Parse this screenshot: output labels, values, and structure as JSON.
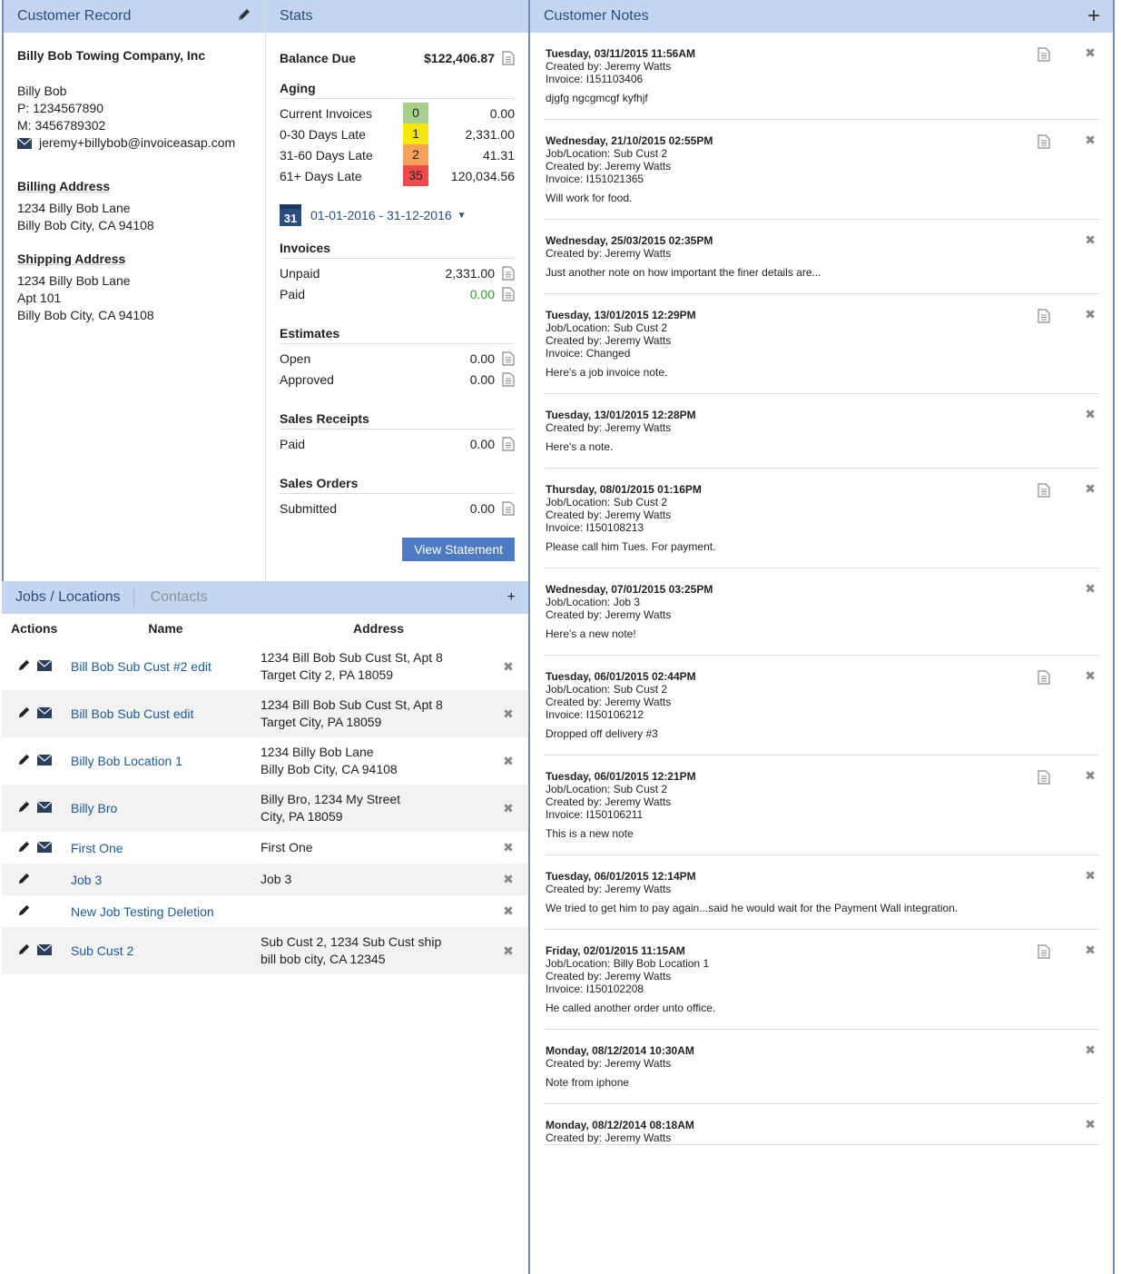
{
  "customer": {
    "header": "Customer Record",
    "company": "Billy Bob Towing Company, Inc",
    "name": "Billy Bob",
    "phone": "P: 1234567890",
    "mobile": "M: 3456789302",
    "email": "jeremy+billybob@invoiceasap.com",
    "billing_title": "Billing Address",
    "billing": [
      "1234 Billy Bob Lane",
      "Billy Bob City, CA 94108"
    ],
    "shipping_title": "Shipping Address",
    "shipping": [
      "1234 Billy Bob Lane",
      "Apt 101",
      "Billy Bob City, CA 94108"
    ]
  },
  "stats": {
    "header": "Stats",
    "balance_label": "Balance Due",
    "balance_value": "$122,406.87",
    "aging_title": "Aging",
    "aging": [
      {
        "label": "Current Invoices",
        "count": "0",
        "amount": "0.00",
        "color": "#a8d08d"
      },
      {
        "label": "0-30 Days Late",
        "count": "1",
        "amount": "2,331.00",
        "color": "#f5e60b"
      },
      {
        "label": "31-60 Days Late",
        "count": "2",
        "amount": "41.31",
        "color": "#f7a05a"
      },
      {
        "label": "61+ Days Late",
        "count": "35",
        "amount": "120,034.56",
        "color": "#ef4b4b"
      }
    ],
    "calendar_day": "31",
    "date_range": "01-01-2016 - 31-12-2016",
    "invoices_title": "Invoices",
    "unpaid_label": "Unpaid",
    "unpaid_value": "2,331.00",
    "paid_label": "Paid",
    "paid_value": "0.00",
    "estimates_title": "Estimates",
    "open_label": "Open",
    "open_value": "0.00",
    "approved_label": "Approved",
    "approved_value": "0.00",
    "receipts_title": "Sales Receipts",
    "receipts_paid_label": "Paid",
    "receipts_paid_value": "0.00",
    "orders_title": "Sales Orders",
    "submitted_label": "Submitted",
    "submitted_value": "0.00",
    "view_statement": "View Statement"
  },
  "jobs": {
    "tab_jobs": "Jobs / Locations",
    "tab_contacts": "Contacts",
    "col_actions": "Actions",
    "col_name": "Name",
    "col_address": "Address",
    "rows": [
      {
        "name": "Bill Bob Sub Cust #2 edit",
        "addr1": "1234 Bill Bob Sub Cust St, Apt 8",
        "addr2": "Target City 2, PA 18059",
        "mail": true
      },
      {
        "name": "Bill Bob Sub Cust edit",
        "addr1": "1234 Bill Bob Sub Cust St, Apt 8",
        "addr2": "Target City, PA 18059",
        "mail": true
      },
      {
        "name": "Billy Bob Location 1",
        "addr1": "1234 Billy Bob Lane",
        "addr2": "Billy Bob City, CA 94108",
        "mail": true
      },
      {
        "name": "Billy Bro",
        "addr1": "Billy Bro, 1234 My Street",
        "addr2": "City, PA 18059",
        "mail": true
      },
      {
        "name": "First One",
        "addr1": "First One",
        "addr2": "",
        "mail": true
      },
      {
        "name": "Job 3",
        "addr1": "Job 3",
        "addr2": "",
        "mail": false
      },
      {
        "name": "New Job Testing Deletion",
        "addr1": "",
        "addr2": "",
        "mail": false
      },
      {
        "name": "Sub Cust 2",
        "addr1": "Sub Cust 2, 1234 Sub Cust ship",
        "addr2": "bill bob city, CA 12345",
        "mail": true
      }
    ]
  },
  "notes": {
    "header": "Customer Notes",
    "items": [
      {
        "date": "Tuesday, 03/11/2015 11:56AM",
        "lines": [
          "Created by: Jeremy Watts",
          "Invoice: I151103406"
        ],
        "body": "djgfg ngcgmcgf kyfhjf",
        "doc": true
      },
      {
        "date": "Wednesday, 21/10/2015 02:55PM",
        "lines": [
          "Job/Location: Sub Cust 2",
          "Created by: Jeremy Watts",
          "Invoice: I151021365"
        ],
        "body": "Will work for food.",
        "doc": true
      },
      {
        "date": "Wednesday, 25/03/2015 02:35PM",
        "lines": [
          "Created by: Jeremy Watts"
        ],
        "body": "Just another note on how important the finer details are...",
        "doc": false
      },
      {
        "date": "Tuesday, 13/01/2015 12:29PM",
        "lines": [
          "Job/Location: Sub Cust 2",
          "Created by: Jeremy Watts",
          "Invoice: Changed"
        ],
        "body": "Here's a job invoice note.",
        "doc": true
      },
      {
        "date": "Tuesday, 13/01/2015 12:28PM",
        "lines": [
          "Created by: Jeremy Watts"
        ],
        "body": "Here's a note.",
        "doc": false
      },
      {
        "date": "Thursday, 08/01/2015 01:16PM",
        "lines": [
          "Job/Location: Sub Cust 2",
          "Created by: Jeremy Watts",
          "Invoice: I150108213"
        ],
        "body": "Please call him Tues. For payment.",
        "doc": true
      },
      {
        "date": "Wednesday, 07/01/2015 03:25PM",
        "lines": [
          "Job/Location: Job 3",
          "Created by: Jeremy Watts"
        ],
        "body": "Here's a new note!",
        "doc": false
      },
      {
        "date": "Tuesday, 06/01/2015 02:44PM",
        "lines": [
          "Job/Location: Sub Cust 2",
          "Created by: Jeremy Watts",
          "Invoice: I150106212"
        ],
        "body": "Dropped off delivery #3",
        "doc": true
      },
      {
        "date": "Tuesday, 06/01/2015 12:21PM",
        "lines": [
          "Job/Location: Sub Cust 2",
          "Created by: Jeremy Watts",
          "Invoice: I150106211"
        ],
        "body": "This is a new note",
        "doc": true
      },
      {
        "date": "Tuesday, 06/01/2015 12:14PM",
        "lines": [
          "Created by: Jeremy Watts"
        ],
        "body": "We tried to get him to pay again...said he would wait for the Payment Wall integration.",
        "doc": false
      },
      {
        "date": "Friday, 02/01/2015 11:15AM",
        "lines": [
          "Job/Location: Billy Bob Location 1",
          "Created by: Jeremy Watts",
          "Invoice: I150102208"
        ],
        "body": "He called another order unto office.",
        "doc": true
      },
      {
        "date": "Monday, 08/12/2014 10:30AM",
        "lines": [
          "Created by: Jeremy Watts"
        ],
        "body": "Note from iphone",
        "doc": false
      },
      {
        "date": "Monday, 08/12/2014 08:18AM",
        "lines": [
          "Created by: Jeremy Watts"
        ],
        "body": "",
        "doc": false
      }
    ]
  }
}
